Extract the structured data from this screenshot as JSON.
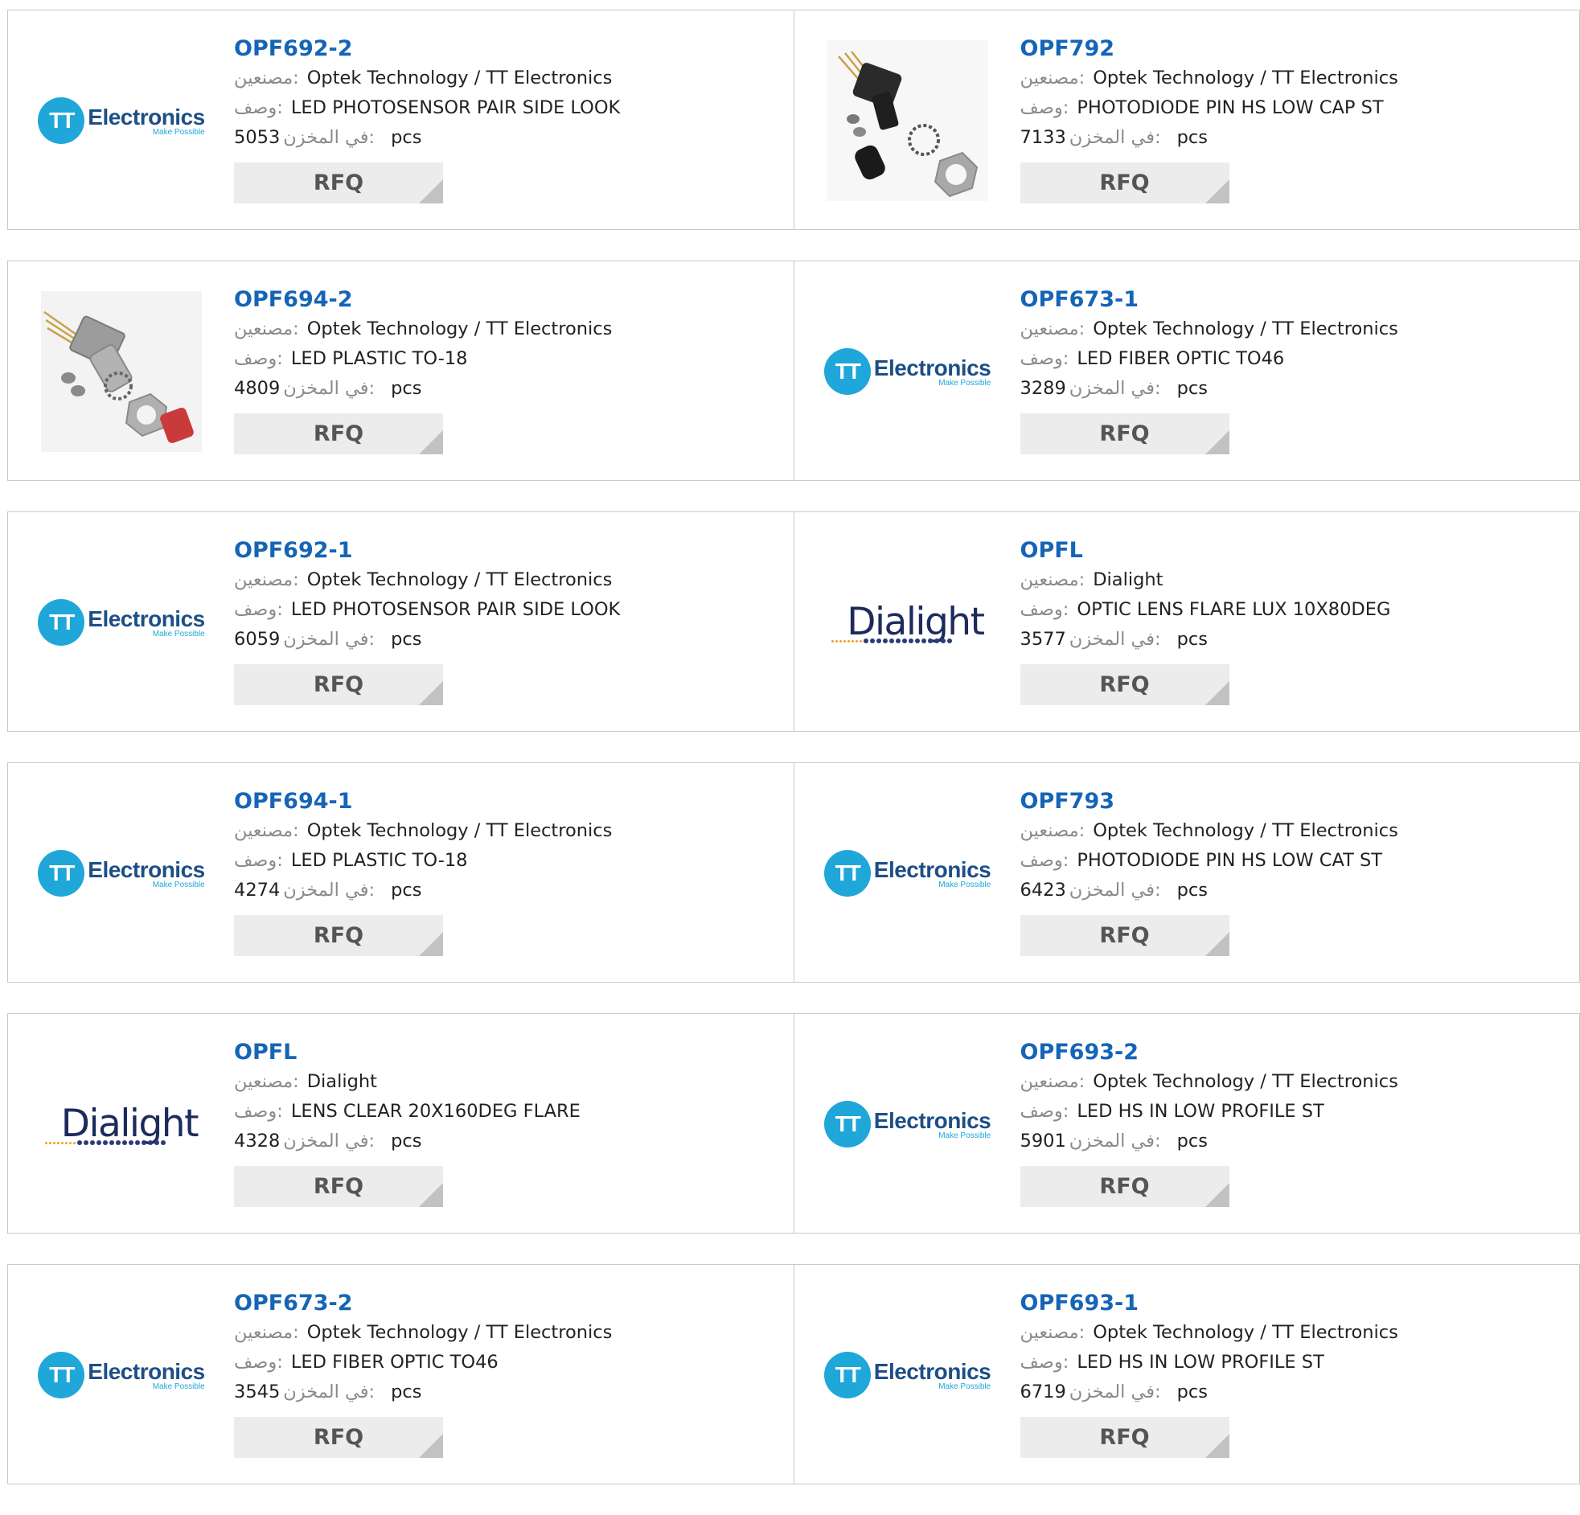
{
  "labels": {
    "manufacturer": "مصنعين:",
    "description": "وصف:",
    "stock": "في المخزن:",
    "unit": "pcs",
    "rfq": "RFQ"
  },
  "logos": {
    "tt_mark": "TT",
    "tt_word": "Electronics",
    "tt_tagline": "Make Possible",
    "dialight_word": "Dialight"
  },
  "colors": {
    "part_link": "#1565b7",
    "tt_blue": "#1fa7d9",
    "tt_navy": "#1d4f86",
    "dialight_navy": "#1d2b5c",
    "rfq_bg": "#ececec"
  },
  "products": [
    {
      "part": "OPF692-2",
      "manufacturer": "Optek Technology / TT Electronics",
      "description": "LED PHOTOSENSOR PAIR SIDE LOOK",
      "stock": "5053",
      "image": "tt-electronics-logo"
    },
    {
      "part": "OPF792",
      "manufacturer": "Optek Technology / TT Electronics",
      "description": "PHOTODIODE PIN HS LOW CAP ST",
      "stock": "7133",
      "image": "black-connector-photo"
    },
    {
      "part": "OPF694-2",
      "manufacturer": "Optek Technology / TT Electronics",
      "description": "LED PLASTIC TO-18",
      "stock": "4809",
      "image": "metal-connector-photo"
    },
    {
      "part": "OPF673-1",
      "manufacturer": "Optek Technology / TT Electronics",
      "description": "LED FIBER OPTIC TO46",
      "stock": "3289",
      "image": "tt-electronics-logo"
    },
    {
      "part": "OPF692-1",
      "manufacturer": "Optek Technology / TT Electronics",
      "description": "LED PHOTOSENSOR PAIR SIDE LOOK",
      "stock": "6059",
      "image": "tt-electronics-logo"
    },
    {
      "part": "OPFL",
      "manufacturer": "Dialight",
      "description": "OPTIC LENS FLARE LUX 10X80DEG",
      "stock": "3577",
      "image": "dialight-logo"
    },
    {
      "part": "OPF694-1",
      "manufacturer": "Optek Technology / TT Electronics",
      "description": "LED PLASTIC TO-18",
      "stock": "4274",
      "image": "tt-electronics-logo"
    },
    {
      "part": "OPF793",
      "manufacturer": "Optek Technology / TT Electronics",
      "description": "PHOTODIODE PIN HS LOW CAT ST",
      "stock": "6423",
      "image": "tt-electronics-logo"
    },
    {
      "part": "OPFL",
      "manufacturer": "Dialight",
      "description": "LENS CLEAR 20X160DEG FLARE",
      "stock": "4328",
      "image": "dialight-logo"
    },
    {
      "part": "OPF693-2",
      "manufacturer": "Optek Technology / TT Electronics",
      "description": "LED HS IN LOW PROFILE ST",
      "stock": "5901",
      "image": "tt-electronics-logo"
    },
    {
      "part": "OPF673-2",
      "manufacturer": "Optek Technology / TT Electronics",
      "description": "LED FIBER OPTIC TO46",
      "stock": "3545",
      "image": "tt-electronics-logo"
    },
    {
      "part": "OPF693-1",
      "manufacturer": "Optek Technology / TT Electronics",
      "description": "LED HS IN LOW PROFILE ST",
      "stock": "6719",
      "image": "tt-electronics-logo"
    }
  ]
}
